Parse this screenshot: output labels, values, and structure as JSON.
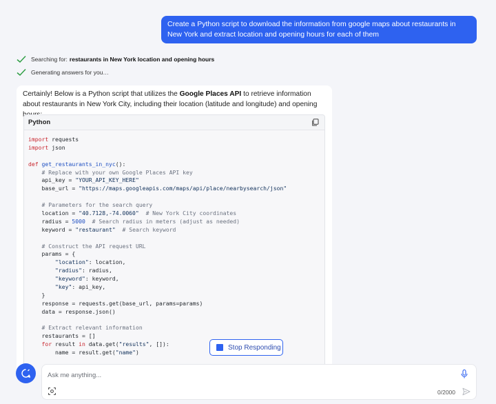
{
  "user_message": "Create a Python script to download the information from google maps about restaurants in New York and extract location and opening hours for each of them",
  "status": [
    {
      "prefix": "Searching for:",
      "query": "restaurants in New York location and opening hours"
    },
    {
      "prefix": "Generating answers for you…",
      "query": ""
    }
  ],
  "answer": {
    "intro_before": "Certainly! Below is a Python script that utilizes the ",
    "intro_bold": "Google Places API",
    "intro_after": " to retrieve information about restaurants in New York City, including their location (latitude and longitude) and opening hours:",
    "code_language": "Python",
    "code_lines": [
      [
        [
          "kw",
          "import"
        ],
        [
          "t",
          " requests"
        ]
      ],
      [
        [
          "kw",
          "import"
        ],
        [
          "t",
          " json"
        ]
      ],
      [],
      [
        [
          "kw",
          "def"
        ],
        [
          "t",
          " "
        ],
        [
          "fn",
          "get_restaurants_in_nyc"
        ],
        [
          "t",
          "():"
        ]
      ],
      [
        [
          "t",
          "    "
        ],
        [
          "cm",
          "# Replace with your own Google Places API key"
        ]
      ],
      [
        [
          "t",
          "    api_key = "
        ],
        [
          "str",
          "\"YOUR_API_KEY_HERE\""
        ]
      ],
      [
        [
          "t",
          "    base_url = "
        ],
        [
          "str",
          "\"https://maps.googleapis.com/maps/api/place/nearbysearch/json\""
        ]
      ],
      [],
      [
        [
          "t",
          "    "
        ],
        [
          "cm",
          "# Parameters for the search query"
        ]
      ],
      [
        [
          "t",
          "    location = "
        ],
        [
          "str",
          "\"40.7128,-74.0060\""
        ],
        [
          "t",
          "  "
        ],
        [
          "cm",
          "# New York City coordinates"
        ]
      ],
      [
        [
          "t",
          "    radius = "
        ],
        [
          "num",
          "5000"
        ],
        [
          "t",
          "  "
        ],
        [
          "cm",
          "# Search radius in meters (adjust as needed)"
        ]
      ],
      [
        [
          "t",
          "    keyword = "
        ],
        [
          "str",
          "\"restaurant\""
        ],
        [
          "t",
          "  "
        ],
        [
          "cm",
          "# Search keyword"
        ]
      ],
      [],
      [
        [
          "t",
          "    "
        ],
        [
          "cm",
          "# Construct the API request URL"
        ]
      ],
      [
        [
          "t",
          "    params = {"
        ]
      ],
      [
        [
          "t",
          "        "
        ],
        [
          "str",
          "\"location\""
        ],
        [
          "t",
          ": location,"
        ]
      ],
      [
        [
          "t",
          "        "
        ],
        [
          "str",
          "\"radius\""
        ],
        [
          "t",
          ": radius,"
        ]
      ],
      [
        [
          "t",
          "        "
        ],
        [
          "str",
          "\"keyword\""
        ],
        [
          "t",
          ": keyword,"
        ]
      ],
      [
        [
          "t",
          "        "
        ],
        [
          "str",
          "\"key\""
        ],
        [
          "t",
          ": api_key,"
        ]
      ],
      [
        [
          "t",
          "    }"
        ]
      ],
      [
        [
          "t",
          "    response = requests.get(base_url, params=params)"
        ]
      ],
      [
        [
          "t",
          "    data = response.json()"
        ]
      ],
      [],
      [
        [
          "t",
          "    "
        ],
        [
          "cm",
          "# Extract relevant information"
        ]
      ],
      [
        [
          "t",
          "    restaurants = []"
        ]
      ],
      [
        [
          "t",
          "    "
        ],
        [
          "kw",
          "for"
        ],
        [
          "t",
          " result "
        ],
        [
          "kw",
          "in"
        ],
        [
          "t",
          " data.get("
        ],
        [
          "str",
          "\"results\""
        ],
        [
          "t",
          ", []):"
        ]
      ],
      [
        [
          "t",
          "        name = result.get("
        ],
        [
          "str",
          "\"name\""
        ],
        [
          "t",
          ")"
        ]
      ]
    ]
  },
  "stop_button": {
    "label": "Stop Responding"
  },
  "composer": {
    "placeholder": "Ask me anything...",
    "counter": "0/2000"
  },
  "colors": {
    "accent": "#2e62f0",
    "check": "#2f9e44"
  }
}
